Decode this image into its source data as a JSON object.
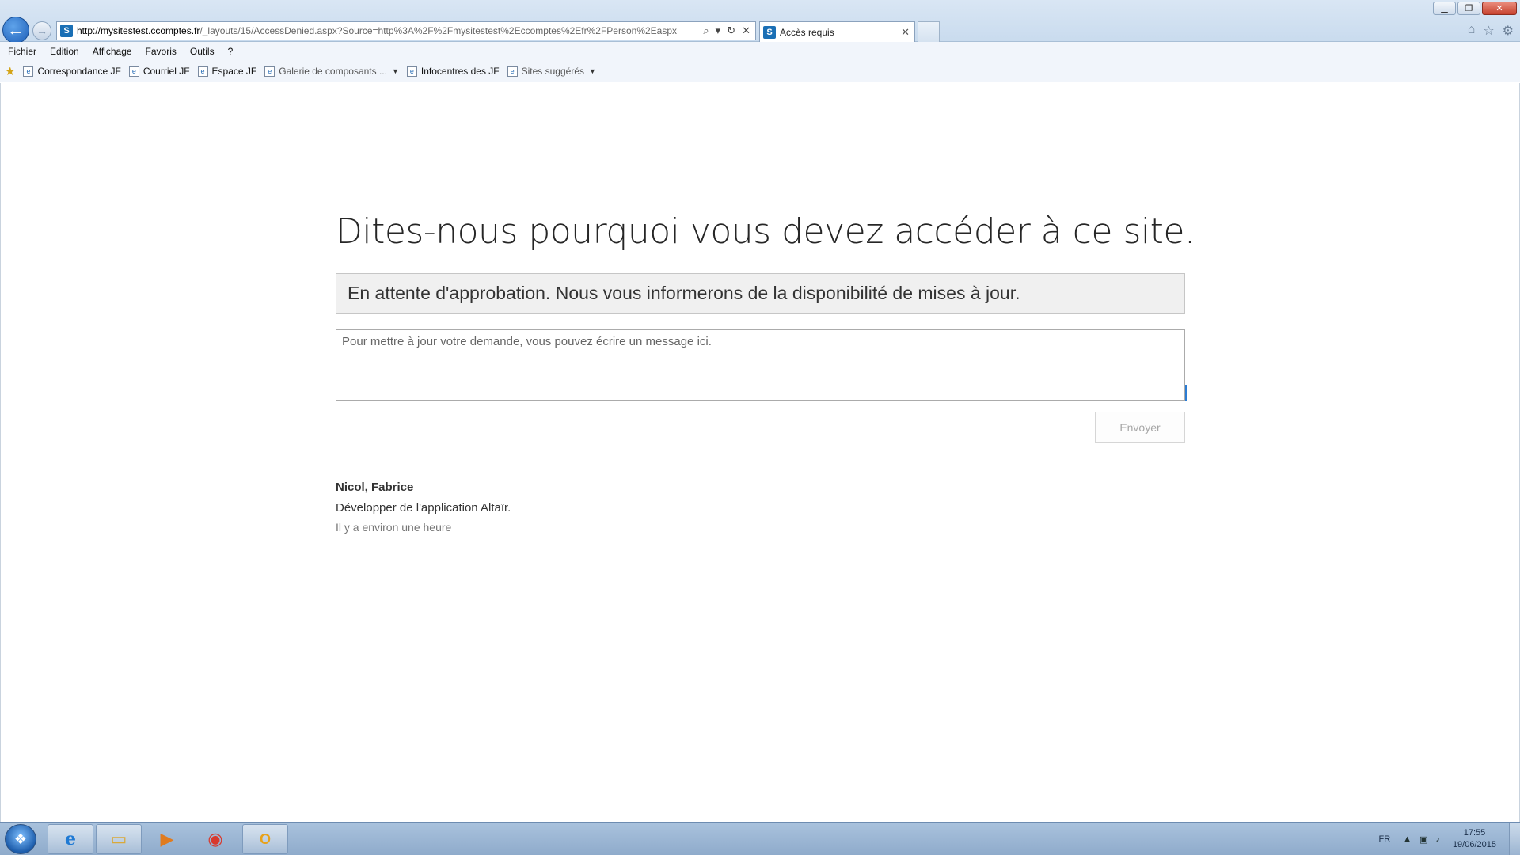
{
  "browser": {
    "url_host": "http://mysitestest.ccomptes.fr",
    "url_path": "/_layouts/15/AccessDenied.aspx?Source=http%3A%2F%2Fmysitestest%2Eccomptes%2Efr%2FPerson%2Easpx",
    "tab_title": "Accès requis",
    "tab_close": "✕",
    "window_minimize": "▁",
    "window_restore": "❐",
    "window_close": "✕"
  },
  "menu": [
    "Fichier",
    "Edition",
    "Affichage",
    "Favoris",
    "Outils",
    "?"
  ],
  "favorites": [
    {
      "label": "Correspondance JF"
    },
    {
      "label": "Courriel JF"
    },
    {
      "label": "Espace JF"
    },
    {
      "label": "Galerie de composants ..."
    },
    {
      "label": "Infocentres des JF"
    },
    {
      "label": "Sites suggérés"
    }
  ],
  "page": {
    "title": "Dites-nous pourquoi vous devez accéder à ce site.",
    "status": "En attente d'approbation. Nous vous informerons de la disponibilité de mises à jour.",
    "message_placeholder": "Pour mettre à jour votre demande, vous pouvez écrire un message ici.",
    "send_label": "Envoyer",
    "requester_name": "Nicol, Fabrice",
    "request_text": "Développer de l'application Altaïr.",
    "request_time": "Il y a environ une heure"
  },
  "taskbar": {
    "language": "FR",
    "time": "17:55",
    "date": "19/06/2015"
  },
  "colors": {
    "accent": "#1c5eb8",
    "status_box_bg": "#f0f0f0",
    "caret": "#2b7cd3"
  }
}
